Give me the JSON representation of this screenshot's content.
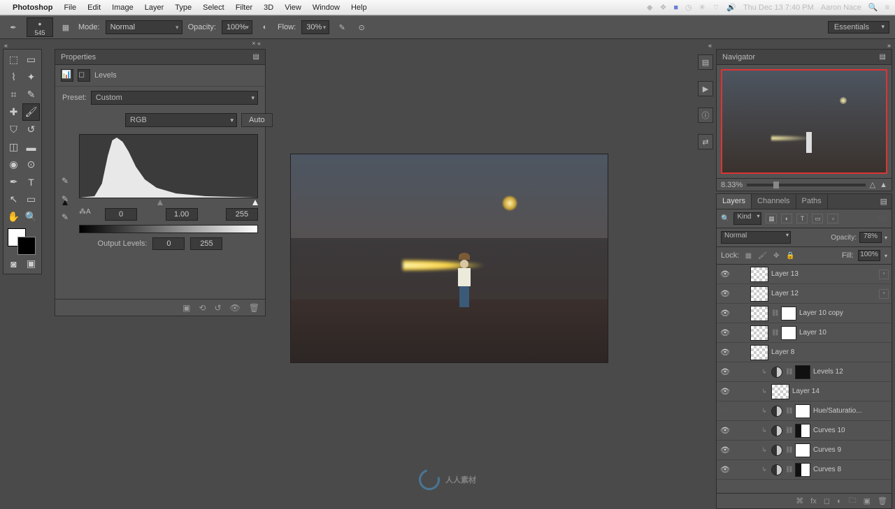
{
  "menubar": {
    "app": "Photoshop",
    "items": [
      "File",
      "Edit",
      "Image",
      "Layer",
      "Type",
      "Select",
      "Filter",
      "3D",
      "View",
      "Window",
      "Help"
    ],
    "clock": "Thu Dec 13  7:40 PM",
    "user": "Aaron Nace"
  },
  "options": {
    "brush_size": "545",
    "mode_label": "Mode:",
    "mode_value": "Normal",
    "opacity_label": "Opacity:",
    "opacity_value": "100%",
    "flow_label": "Flow:",
    "flow_value": "30%",
    "workspace": "Essentials"
  },
  "properties": {
    "tab": "Properties",
    "title": "Levels",
    "preset_label": "Preset:",
    "preset_value": "Custom",
    "channel": "RGB",
    "auto": "Auto",
    "input_black": "0",
    "input_gamma": "1.00",
    "input_white": "255",
    "output_label": "Output Levels:",
    "output_black": "0",
    "output_white": "255"
  },
  "navigator": {
    "tab": "Navigator",
    "zoom": "8.33%"
  },
  "layers_panel": {
    "tabs": [
      "Layers",
      "Channels",
      "Paths"
    ],
    "kind": "Kind",
    "blend": "Normal",
    "opacity_label": "Opacity:",
    "opacity_value": "78%",
    "lock_label": "Lock:",
    "fill_label": "Fill:",
    "fill_value": "100%",
    "layers": [
      {
        "vis": true,
        "indent": 0,
        "thumb": "checker",
        "mask": null,
        "name": "Layer 13",
        "smart": true
      },
      {
        "vis": true,
        "indent": 0,
        "thumb": "checker",
        "mask": null,
        "name": "Layer 12",
        "smart": true
      },
      {
        "vis": true,
        "indent": 0,
        "thumb": "checker",
        "link": true,
        "mask": "white",
        "name": "Layer 10 copy"
      },
      {
        "vis": true,
        "indent": 0,
        "thumb": "checker",
        "link": true,
        "mask": "white",
        "name": "Layer 10"
      },
      {
        "vis": true,
        "indent": 0,
        "thumb": "checker",
        "mask": null,
        "name": "Layer 8"
      },
      {
        "vis": true,
        "indent": 1,
        "thumb": "adj",
        "link": true,
        "mask": "dark",
        "name": "Levels 12"
      },
      {
        "vis": true,
        "indent": 1,
        "thumb": "checker",
        "mask": null,
        "name": "Layer 14"
      },
      {
        "vis": false,
        "indent": 1,
        "thumb": "adj",
        "link": true,
        "mask": "white",
        "name": "Hue/Saturatio..."
      },
      {
        "vis": true,
        "indent": 1,
        "thumb": "adj",
        "link": true,
        "mask": "half",
        "name": "Curves 10"
      },
      {
        "vis": true,
        "indent": 1,
        "thumb": "adj",
        "link": true,
        "mask": "white",
        "name": "Curves 9"
      },
      {
        "vis": true,
        "indent": 1,
        "thumb": "adj",
        "link": true,
        "mask": "half",
        "name": "Curves 8"
      }
    ]
  },
  "watermark": "人人素材"
}
